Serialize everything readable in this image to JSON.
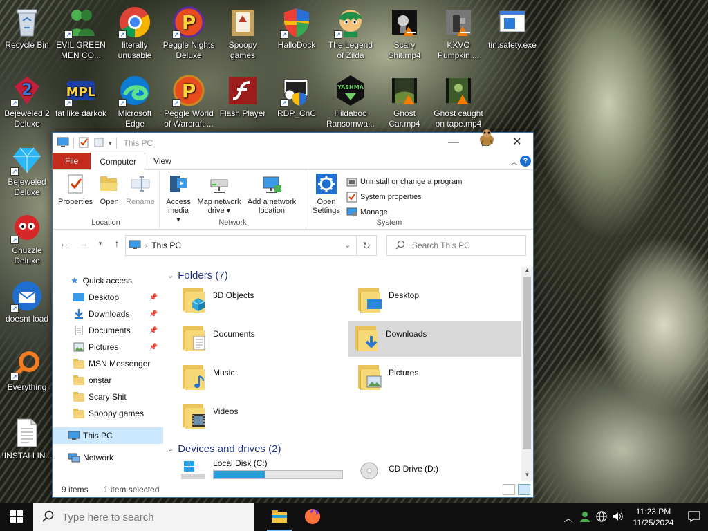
{
  "desktop": {
    "icons": [
      {
        "label1": "Recycle Bin",
        "label2": "",
        "icon": "recycle-bin-icon"
      },
      {
        "label1": "EVIL GREEN",
        "label2": "MEN CO...",
        "icon": "green-men-icon"
      },
      {
        "label1": "literally",
        "label2": "unusable",
        "icon": "chrome-icon"
      },
      {
        "label1": "Peggle Nights",
        "label2": "Deluxe",
        "icon": "peggle-icon"
      },
      {
        "label1": "Spoopy",
        "label2": "games",
        "icon": "folder-icon"
      },
      {
        "label1": "HalloDock",
        "label2": "",
        "icon": "shield-icon"
      },
      {
        "label1": "The Legend",
        "label2": "of Zilda",
        "icon": "game-character-icon"
      },
      {
        "label1": "Scary",
        "label2": "Shit.mp4",
        "icon": "video-icon"
      },
      {
        "label1": "KXVO",
        "label2": "Pumpkin ...",
        "icon": "video-icon"
      },
      {
        "label1": "tin.safety.exe",
        "label2": "",
        "icon": "window-app-icon"
      },
      {
        "label1": "Bejeweled 2",
        "label2": "Deluxe",
        "icon": "bejeweled2-icon"
      },
      {
        "label1": "fat like darkok",
        "label2": "",
        "icon": "mpl-icon"
      },
      {
        "label1": "Microsoft",
        "label2": "Edge",
        "icon": "edge-icon"
      },
      {
        "label1": "Peggle World",
        "label2": "of Warcraft ...",
        "icon": "peggle-icon"
      },
      {
        "label1": "Flash Player",
        "label2": "",
        "icon": "flash-icon"
      },
      {
        "label1": "RDP_CnC",
        "label2": "",
        "icon": "rdp-icon"
      },
      {
        "label1": "Hildaboo",
        "label2": "Ransomwa...",
        "icon": "yashma-icon"
      },
      {
        "label1": "Ghost",
        "label2": "Car.mp4",
        "icon": "video-icon"
      },
      {
        "label1": "Ghost caught",
        "label2": "on tape.mp4",
        "icon": "video-icon"
      },
      {
        "label1": "Bejeweled",
        "label2": "Deluxe",
        "icon": "gem-icon"
      },
      {
        "label1": "Chuzzle",
        "label2": "Deluxe",
        "icon": "chuzzle-icon"
      },
      {
        "label1": "doesnt load",
        "label2": "",
        "icon": "thunderbird-icon"
      },
      {
        "label1": "Everything",
        "label2": "",
        "icon": "everything-icon"
      },
      {
        "label1": "!INSTALLIN...",
        "label2": "",
        "icon": "document-icon"
      }
    ],
    "yashma_text": "YASHMA"
  },
  "window": {
    "title": "This PC",
    "controls": {
      "minimize": "—",
      "maximize": "☐",
      "close": "✕"
    },
    "tabs": {
      "file": "File",
      "computer": "Computer",
      "view": "View"
    },
    "ribbon": {
      "location": {
        "name": "Location",
        "properties": "Properties",
        "open": "Open",
        "rename": "Rename"
      },
      "network": {
        "name": "Network",
        "access_media": "Access media ▾",
        "map_drive": "Map network drive ▾",
        "add_location": "Add a network location"
      },
      "system": {
        "name": "System",
        "open_settings": "Open Settings",
        "uninstall": "Uninstall or change a program",
        "system_properties": "System properties",
        "manage": "Manage"
      }
    },
    "address": {
      "path": "This PC",
      "search_placeholder": "Search This PC"
    },
    "nav": {
      "quick_access": "Quick access",
      "items": [
        {
          "label": "Desktop",
          "pinned": true
        },
        {
          "label": "Downloads",
          "pinned": true
        },
        {
          "label": "Documents",
          "pinned": true
        },
        {
          "label": "Pictures",
          "pinned": true
        },
        {
          "label": "MSN Messenger",
          "pinned": false
        },
        {
          "label": "onstar",
          "pinned": false
        },
        {
          "label": "Scary Shit",
          "pinned": false
        },
        {
          "label": "Spoopy games",
          "pinned": false
        }
      ],
      "this_pc": "This PC",
      "network": "Network"
    },
    "content": {
      "folders_header": "Folders (7)",
      "folders": [
        "3D Objects",
        "Desktop",
        "Documents",
        "Downloads",
        "Music",
        "Pictures",
        "Videos"
      ],
      "selected": "Downloads",
      "devices_header": "Devices and drives (2)",
      "drives": [
        {
          "label": "Local Disk (C:)",
          "used_fraction": 0.4
        },
        {
          "label": "CD Drive (D:)"
        }
      ]
    },
    "status": {
      "items": "9 items",
      "selected": "1 item selected"
    }
  },
  "taskbar": {
    "search_placeholder": "Type here to search",
    "time": "11:23 PM",
    "date": "11/25/2024"
  },
  "colors": {
    "accent": "#0078d7",
    "file_tab": "#c42b1c",
    "selection": "#cce8ff",
    "folder": "#f6d877"
  }
}
